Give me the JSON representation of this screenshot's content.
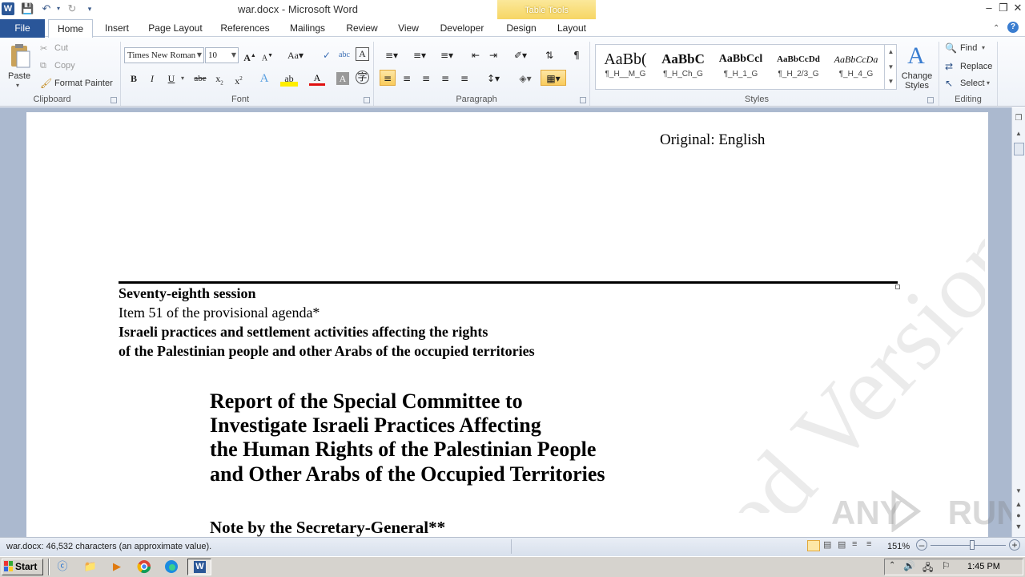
{
  "window": {
    "title": "war.docx - Microsoft Word",
    "contextual_tab_group": "Table Tools",
    "quick_access": [
      "save-icon",
      "undo-icon",
      "redo-icon",
      "customize-icon"
    ]
  },
  "tabs": [
    "File",
    "Home",
    "Insert",
    "Page Layout",
    "References",
    "Mailings",
    "Review",
    "View",
    "Developer",
    "Design",
    "Layout"
  ],
  "ribbon": {
    "clipboard": {
      "paste": "Paste",
      "cut": "Cut",
      "copy": "Copy",
      "format_painter": "Format Painter",
      "label": "Clipboard"
    },
    "font": {
      "name": "Times New Roman",
      "size": "10",
      "label": "Font"
    },
    "paragraph": {
      "label": "Paragraph"
    },
    "styles": {
      "items": [
        {
          "sample": "AaBb(",
          "name": "¶_H__M_G"
        },
        {
          "sample": "AaBbC",
          "name": "¶_H_Ch_G"
        },
        {
          "sample": "AaBbCcl",
          "name": "¶_H_1_G"
        },
        {
          "sample": "AaBbCcDd",
          "name": "¶_H_2/3_G"
        },
        {
          "sample": "AaBbCcDa",
          "name": "¶_H_4_G"
        }
      ],
      "change_styles": "Change Styles",
      "label": "Styles"
    },
    "editing": {
      "find": "Find",
      "replace": "Replace",
      "select": "Select",
      "label": "Editing"
    }
  },
  "document": {
    "original": "Original: English",
    "session": "Seventy-eighth session",
    "item": "Item 51 of the provisional agenda*",
    "agenda_line1": "Israeli practices and settlement activities affecting the rights",
    "agenda_line2": "of the Palestinian people and other Arabs of the occupied territories",
    "report_title": [
      "Report of the Special Committee to",
      "Investigate Israeli Practices Affecting",
      "the Human Rights of the Palestinian People",
      "and Other Arabs of the Occupied Territories"
    ],
    "note": "Note by the Secretary-General**",
    "watermark": "ed Version"
  },
  "status": {
    "text": "war.docx: 46,532 characters (an approximate value).",
    "zoom": "151%"
  },
  "taskbar": {
    "start": "Start",
    "clock": "1:45 PM"
  },
  "overlay_logo": "ANY RUN"
}
